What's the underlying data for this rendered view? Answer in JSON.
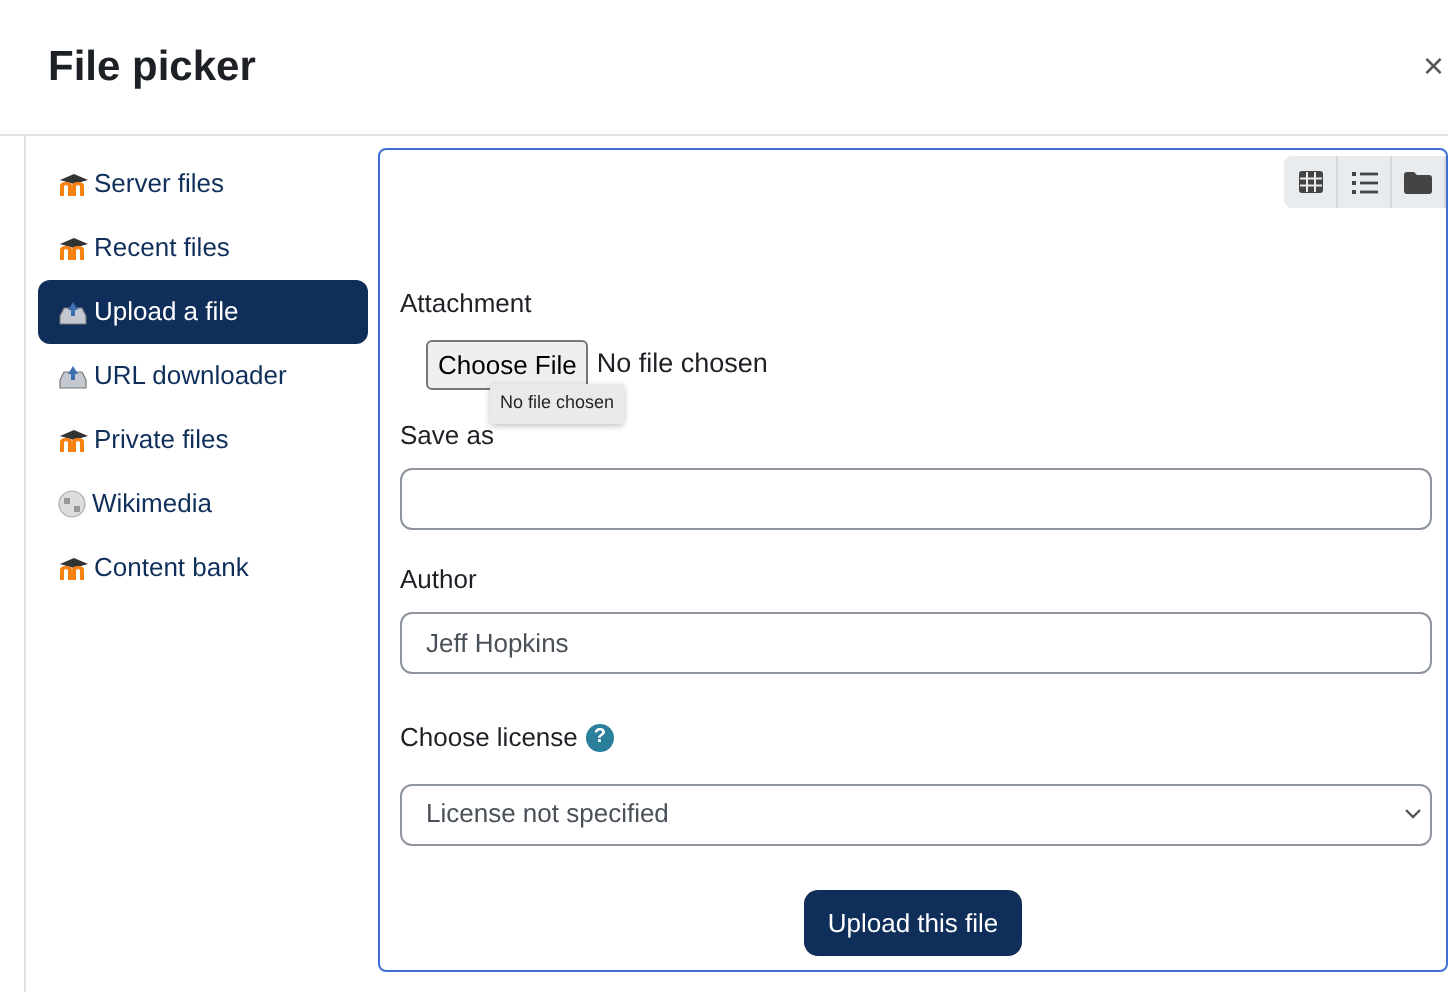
{
  "dialog": {
    "title": "File picker",
    "close": "×"
  },
  "sidebar": {
    "items": [
      {
        "label": "Server files",
        "kind": "repository",
        "selected": false
      },
      {
        "label": "Recent files",
        "kind": "repository",
        "selected": false
      },
      {
        "label": "Upload a file",
        "kind": "upload",
        "selected": true
      },
      {
        "label": "URL downloader",
        "kind": "upload",
        "selected": false
      },
      {
        "label": "Private files",
        "kind": "repository",
        "selected": false
      },
      {
        "label": "Wikimedia",
        "kind": "external",
        "selected": false
      },
      {
        "label": "Content bank",
        "kind": "repository",
        "selected": false
      }
    ]
  },
  "toolbar": {
    "buttons": [
      {
        "kind": "grid"
      },
      {
        "kind": "list"
      },
      {
        "kind": "tree"
      }
    ]
  },
  "form": {
    "attachment": {
      "label": "Attachment",
      "button": "Choose File",
      "status": "No file chosen",
      "tooltip": "No file chosen"
    },
    "save_as": {
      "label": "Save as"
    },
    "author": {
      "label": "Author",
      "value": "Jeff Hopkins"
    },
    "license": {
      "label": "Choose license",
      "help": "?",
      "value": "License not specified"
    },
    "submit": "Upload this file"
  }
}
